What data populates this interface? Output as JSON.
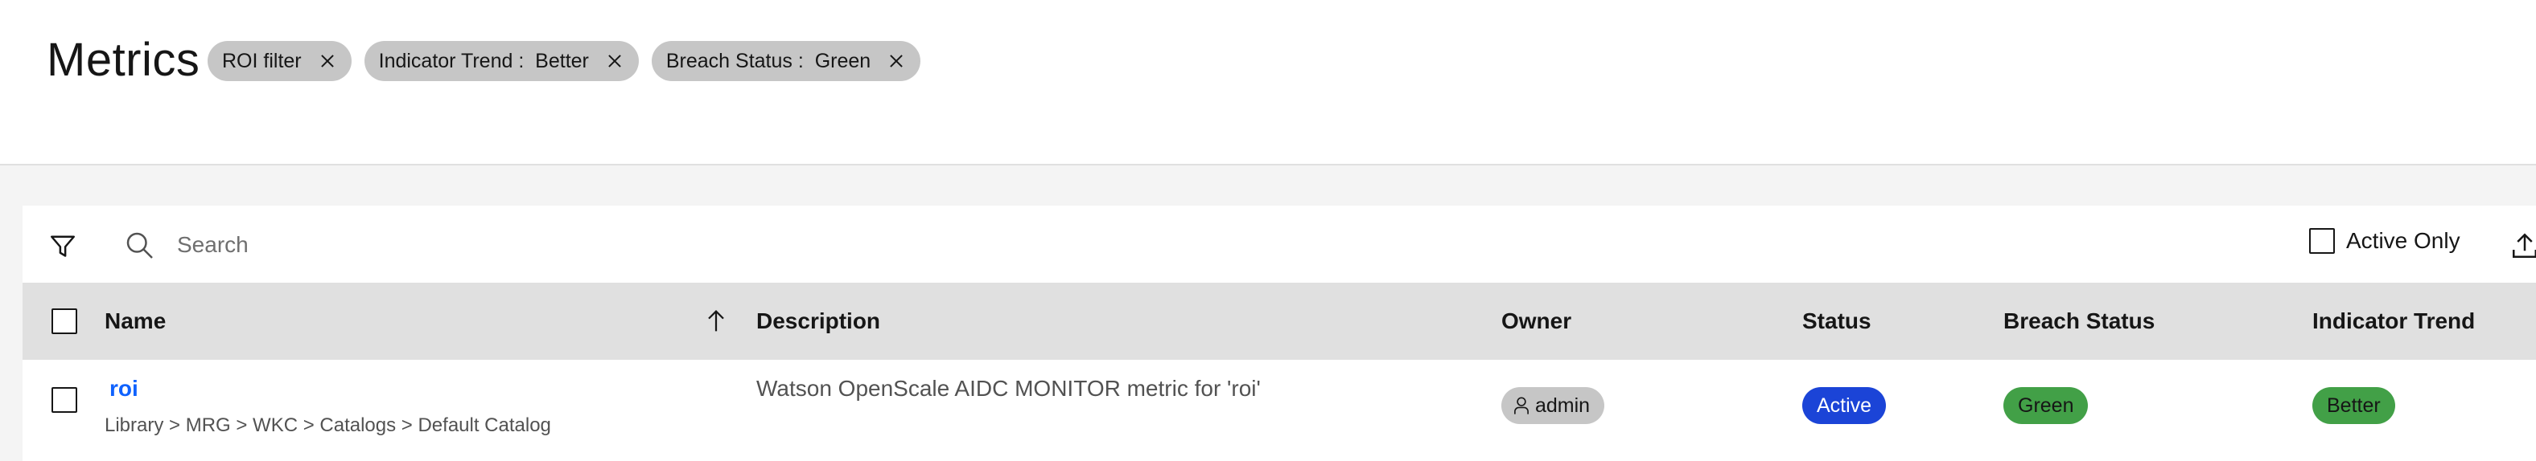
{
  "header": {
    "title": "Metrics",
    "filters": [
      {
        "label": "ROI filter"
      },
      {
        "label": "Indicator Trend :  Better"
      },
      {
        "label": "Breach Status :  Green"
      }
    ]
  },
  "toolbar": {
    "search_placeholder": "Search",
    "active_only_label": "Active Only",
    "active_only_checked": false
  },
  "table": {
    "columns": {
      "name": "Name",
      "description": "Description",
      "owner": "Owner",
      "status": "Status",
      "breach_status": "Breach Status",
      "indicator_trend": "Indicator Trend"
    },
    "sort": {
      "column": "Name",
      "direction": "ascending"
    },
    "rows": [
      {
        "name": "roi",
        "path": "Library > MRG > WKC > Catalogs > Default Catalog",
        "description": "Watson OpenScale AIDC MONITOR metric for 'roi'",
        "owner": "admin",
        "status": "Active",
        "breach_status": "Green",
        "indicator_trend": "Better"
      }
    ]
  },
  "colors": {
    "link": "#0f62fe",
    "status_active": "#1b44d7",
    "green_tag": "#42a047",
    "chip_bg": "#c6c6c6",
    "header_row_bg": "#e0e0e0"
  },
  "icons": [
    "filter-icon",
    "search-icon",
    "close-icon",
    "arrow-up-icon",
    "user-icon",
    "export-icon"
  ]
}
